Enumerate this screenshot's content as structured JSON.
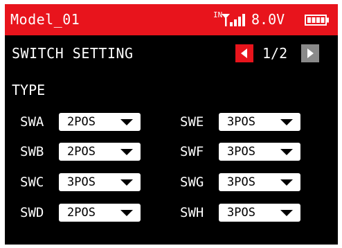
{
  "header": {
    "model_name": "Model_01",
    "signal_label": "IN",
    "voltage": "8.0V",
    "signal_icon": "antenna-signal-icon",
    "battery_icon": "battery-full-icon",
    "bar_color": "#e8141c"
  },
  "title_row": {
    "title": "SWITCH SETTING",
    "page_indicator": "1/2",
    "prev_icon": "triangle-left-icon",
    "next_icon": "triangle-right-icon"
  },
  "type_label": "TYPE",
  "switches": [
    {
      "name": "SWA",
      "value": "2POS"
    },
    {
      "name": "SWB",
      "value": "2POS"
    },
    {
      "name": "SWC",
      "value": "3POS"
    },
    {
      "name": "SWD",
      "value": "2POS"
    },
    {
      "name": "SWE",
      "value": "3POS"
    },
    {
      "name": "SWF",
      "value": "3POS"
    },
    {
      "name": "SWG",
      "value": "3POS"
    },
    {
      "name": "SWH",
      "value": "3POS"
    }
  ]
}
